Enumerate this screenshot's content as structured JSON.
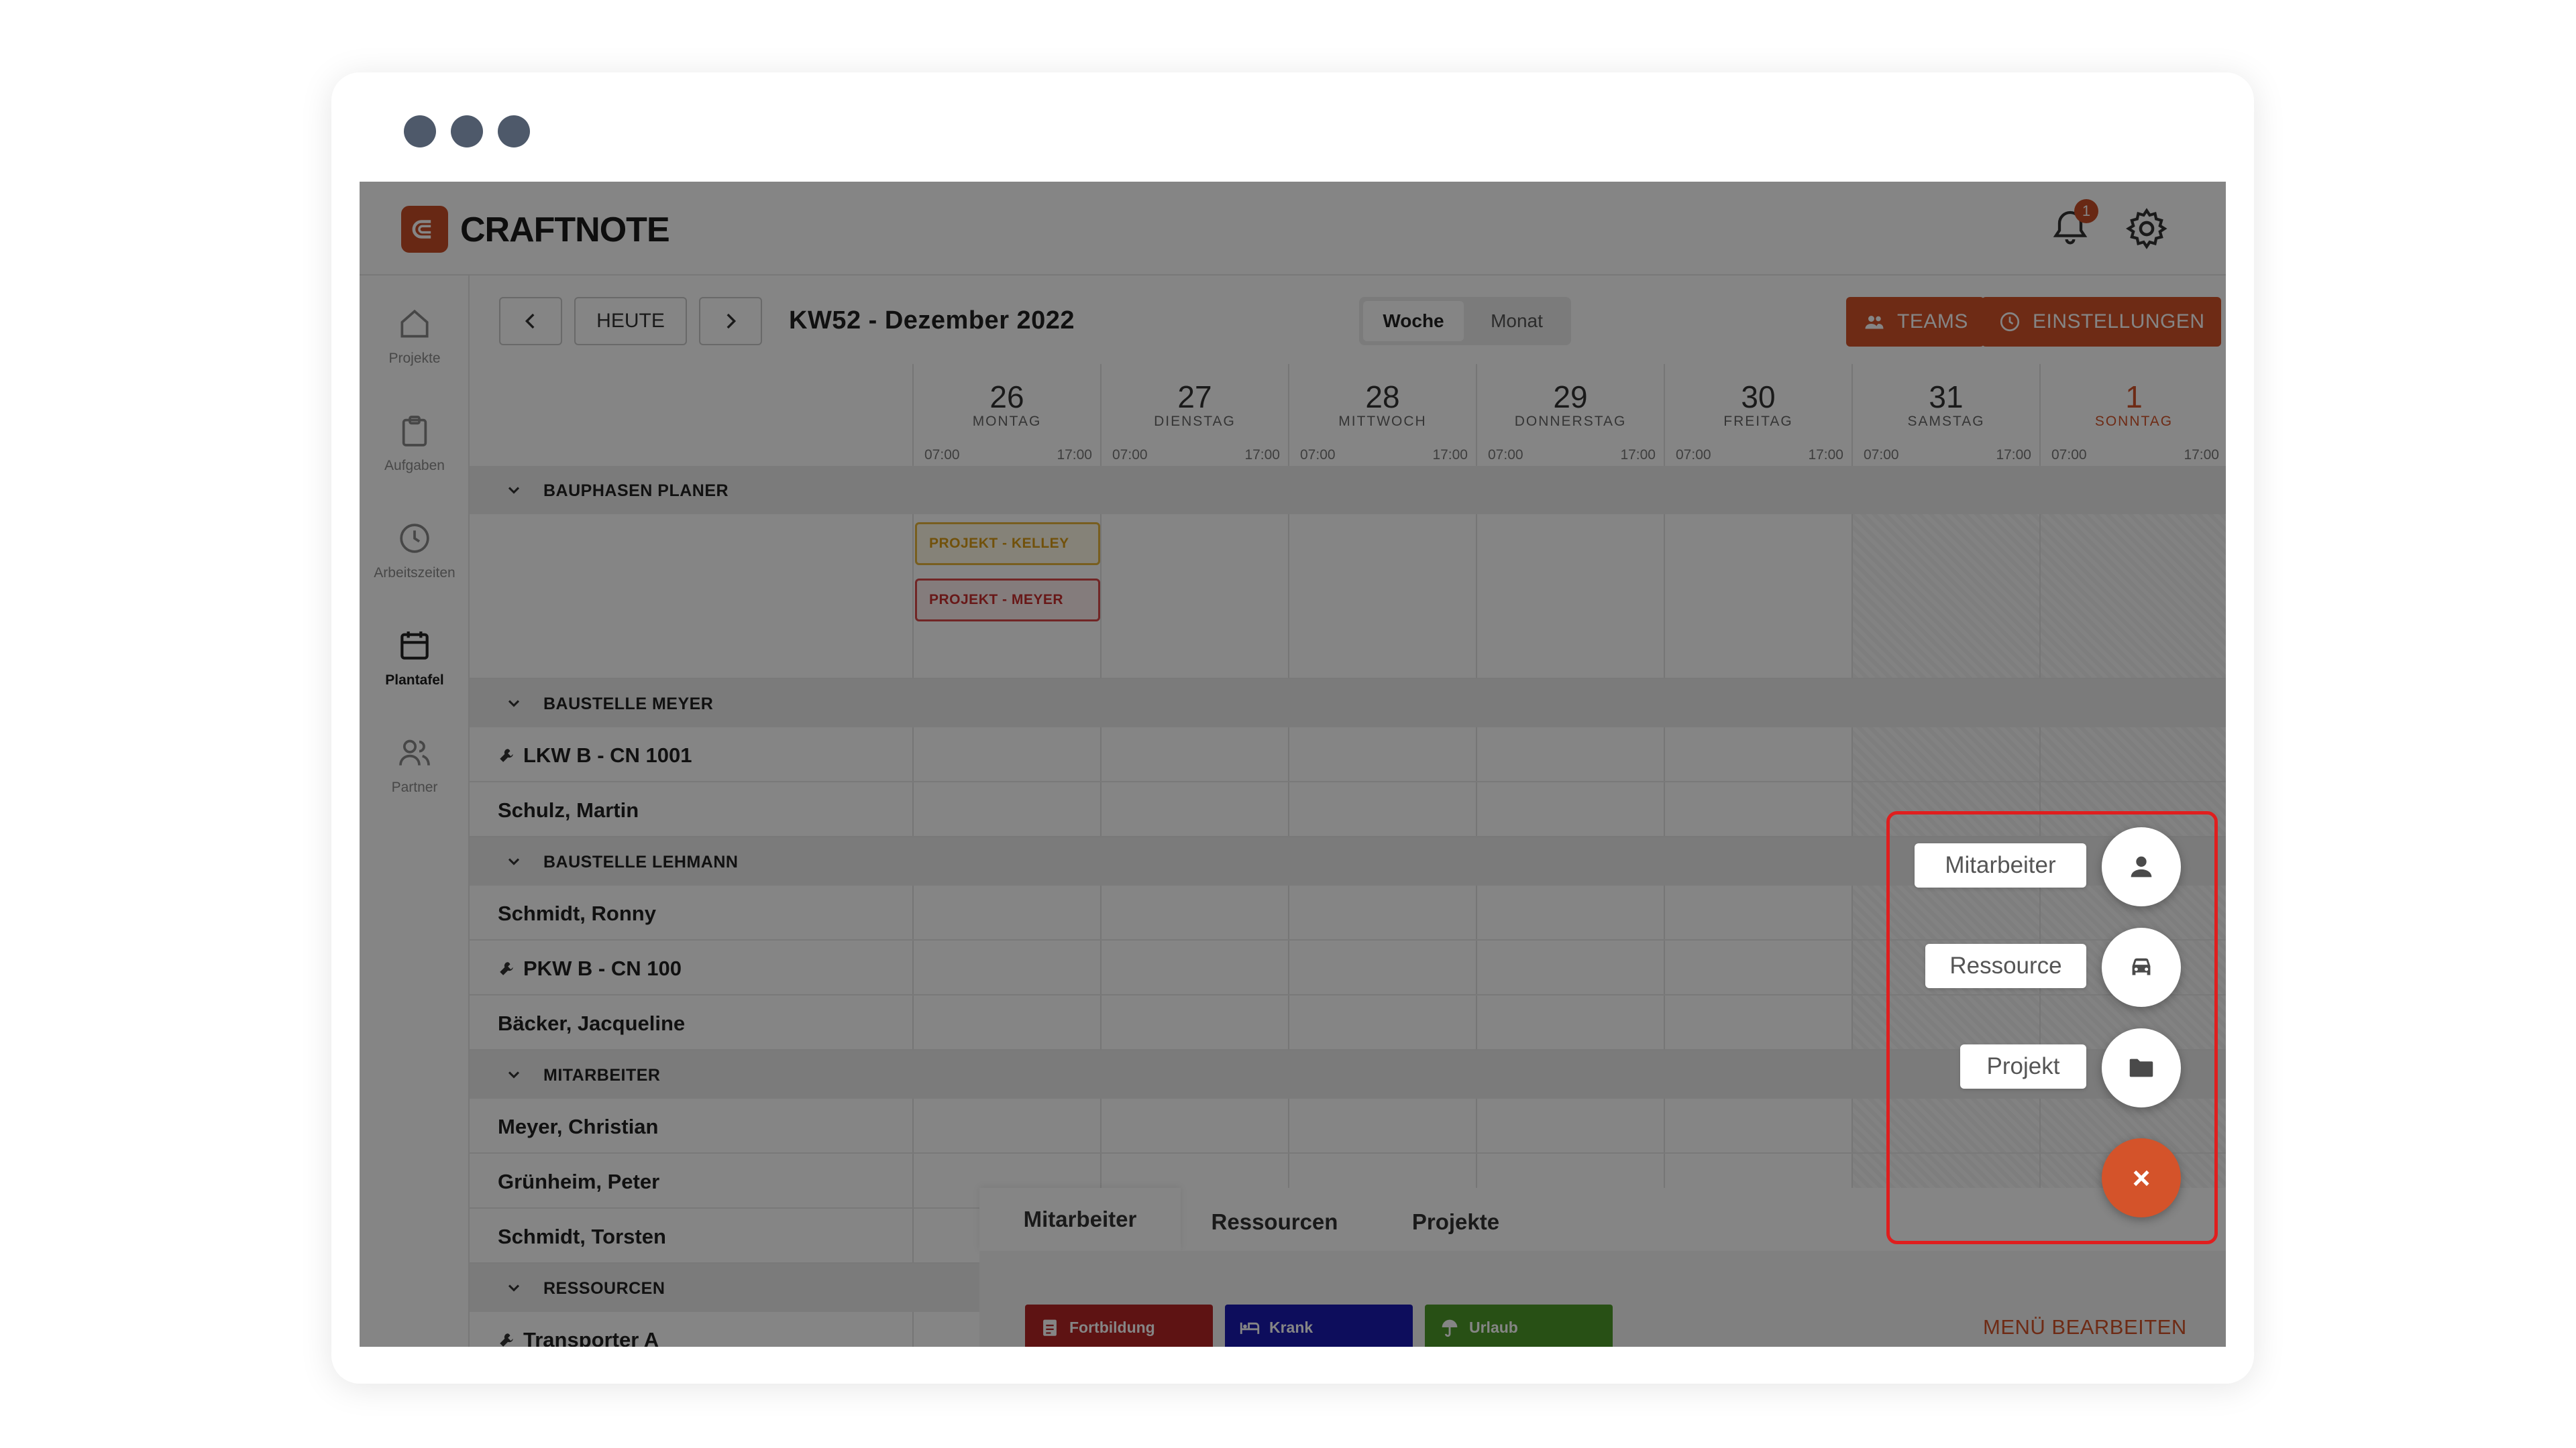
{
  "app": {
    "logo_text": "CRAFTNOTE",
    "notification_count": "1"
  },
  "sidebar": {
    "items": [
      {
        "label": "Projekte",
        "icon": "home-icon"
      },
      {
        "label": "Aufgaben",
        "icon": "clipboard-icon"
      },
      {
        "label": "Arbeitszeiten",
        "icon": "clock-icon"
      },
      {
        "label": "Plantafel",
        "icon": "calendar-icon",
        "active": true
      },
      {
        "label": "Partner",
        "icon": "users-icon"
      }
    ]
  },
  "toolbar": {
    "today_label": "HEUTE",
    "week_title": "KW52 - Dezember 2022",
    "view_week": "Woche",
    "view_month": "Monat",
    "teams_label": "TEAMS",
    "settings_label": "EINSTELLUNGEN"
  },
  "days": [
    {
      "num": "26",
      "name": "MONTAG",
      "start": "07:00",
      "end": "17:00"
    },
    {
      "num": "27",
      "name": "DIENSTAG",
      "start": "07:00",
      "end": "17:00"
    },
    {
      "num": "28",
      "name": "MITTWOCH",
      "start": "07:00",
      "end": "17:00"
    },
    {
      "num": "29",
      "name": "DONNERSTAG",
      "start": "07:00",
      "end": "17:00"
    },
    {
      "num": "30",
      "name": "FREITAG",
      "start": "07:00",
      "end": "17:00"
    },
    {
      "num": "31",
      "name": "SAMSTAG",
      "start": "07:00",
      "end": "17:00"
    },
    {
      "num": "1",
      "name": "SONNTAG",
      "start": "07:00",
      "end": "17:00"
    }
  ],
  "groups": {
    "bauphasen": "BAUPHASEN PLANER",
    "meyer": "BAUSTELLE MEYER",
    "lehmann": "BAUSTELLE LEHMANN",
    "mitarbeiter": "MITARBEITER",
    "ressourcen": "RESSOURCEN"
  },
  "projects": {
    "kelley": "PROJEKT - KELLEY",
    "meyer": "PROJEKT - MEYER"
  },
  "rows": {
    "lkw": "LKW B - CN 1001",
    "schulz": "Schulz, Martin",
    "schmidt_ronny": "Schmidt, Ronny",
    "pkw": "PKW B - CN 100",
    "baecker": "Bäcker, Jacqueline",
    "meyer_christian": "Meyer, Christian",
    "gruenheim": "Grünheim, Peter",
    "schmidt_torsten": "Schmidt, Torsten",
    "transporter": "Transporter A"
  },
  "bottom_panel": {
    "tabs": [
      "Mitarbeiter",
      "Ressourcen",
      "Projekte"
    ],
    "pills": [
      {
        "label": "Fortbildung",
        "color": "#b52525"
      },
      {
        "label": "Krank",
        "color": "#1a1ab0"
      },
      {
        "label": "Urlaub",
        "color": "#4e9a2a"
      }
    ],
    "edit_label": "MENÜ BEARBEITEN"
  },
  "fab_menu": {
    "employee_label": "Mitarbeiter",
    "resource_label": "Ressource",
    "project_label": "Projekt",
    "close_glyph": "×"
  },
  "colors": {
    "accent": "#d4532a",
    "highlight": "#e01e1e"
  }
}
